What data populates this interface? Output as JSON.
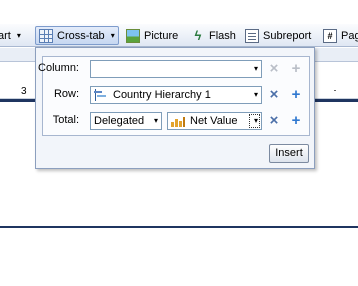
{
  "toolbar": {
    "chart_label": "art",
    "crosstab_label": "Cross-tab",
    "picture_label": "Picture",
    "flash_label": "Flash",
    "subreport_label": "Subreport",
    "page_label": "Pag"
  },
  "background": {
    "cell_value": "3"
  },
  "crosstab_panel": {
    "column_label": "Column:",
    "column_value": "",
    "row_label": "Row:",
    "row_value": "Country Hierarchy 1",
    "total_label": "Total:",
    "total_function": "Delegated",
    "total_measure": "Net Value",
    "insert_label": "Insert"
  },
  "icons": {
    "remove": "×",
    "add": "+",
    "dropdown": "▾"
  }
}
